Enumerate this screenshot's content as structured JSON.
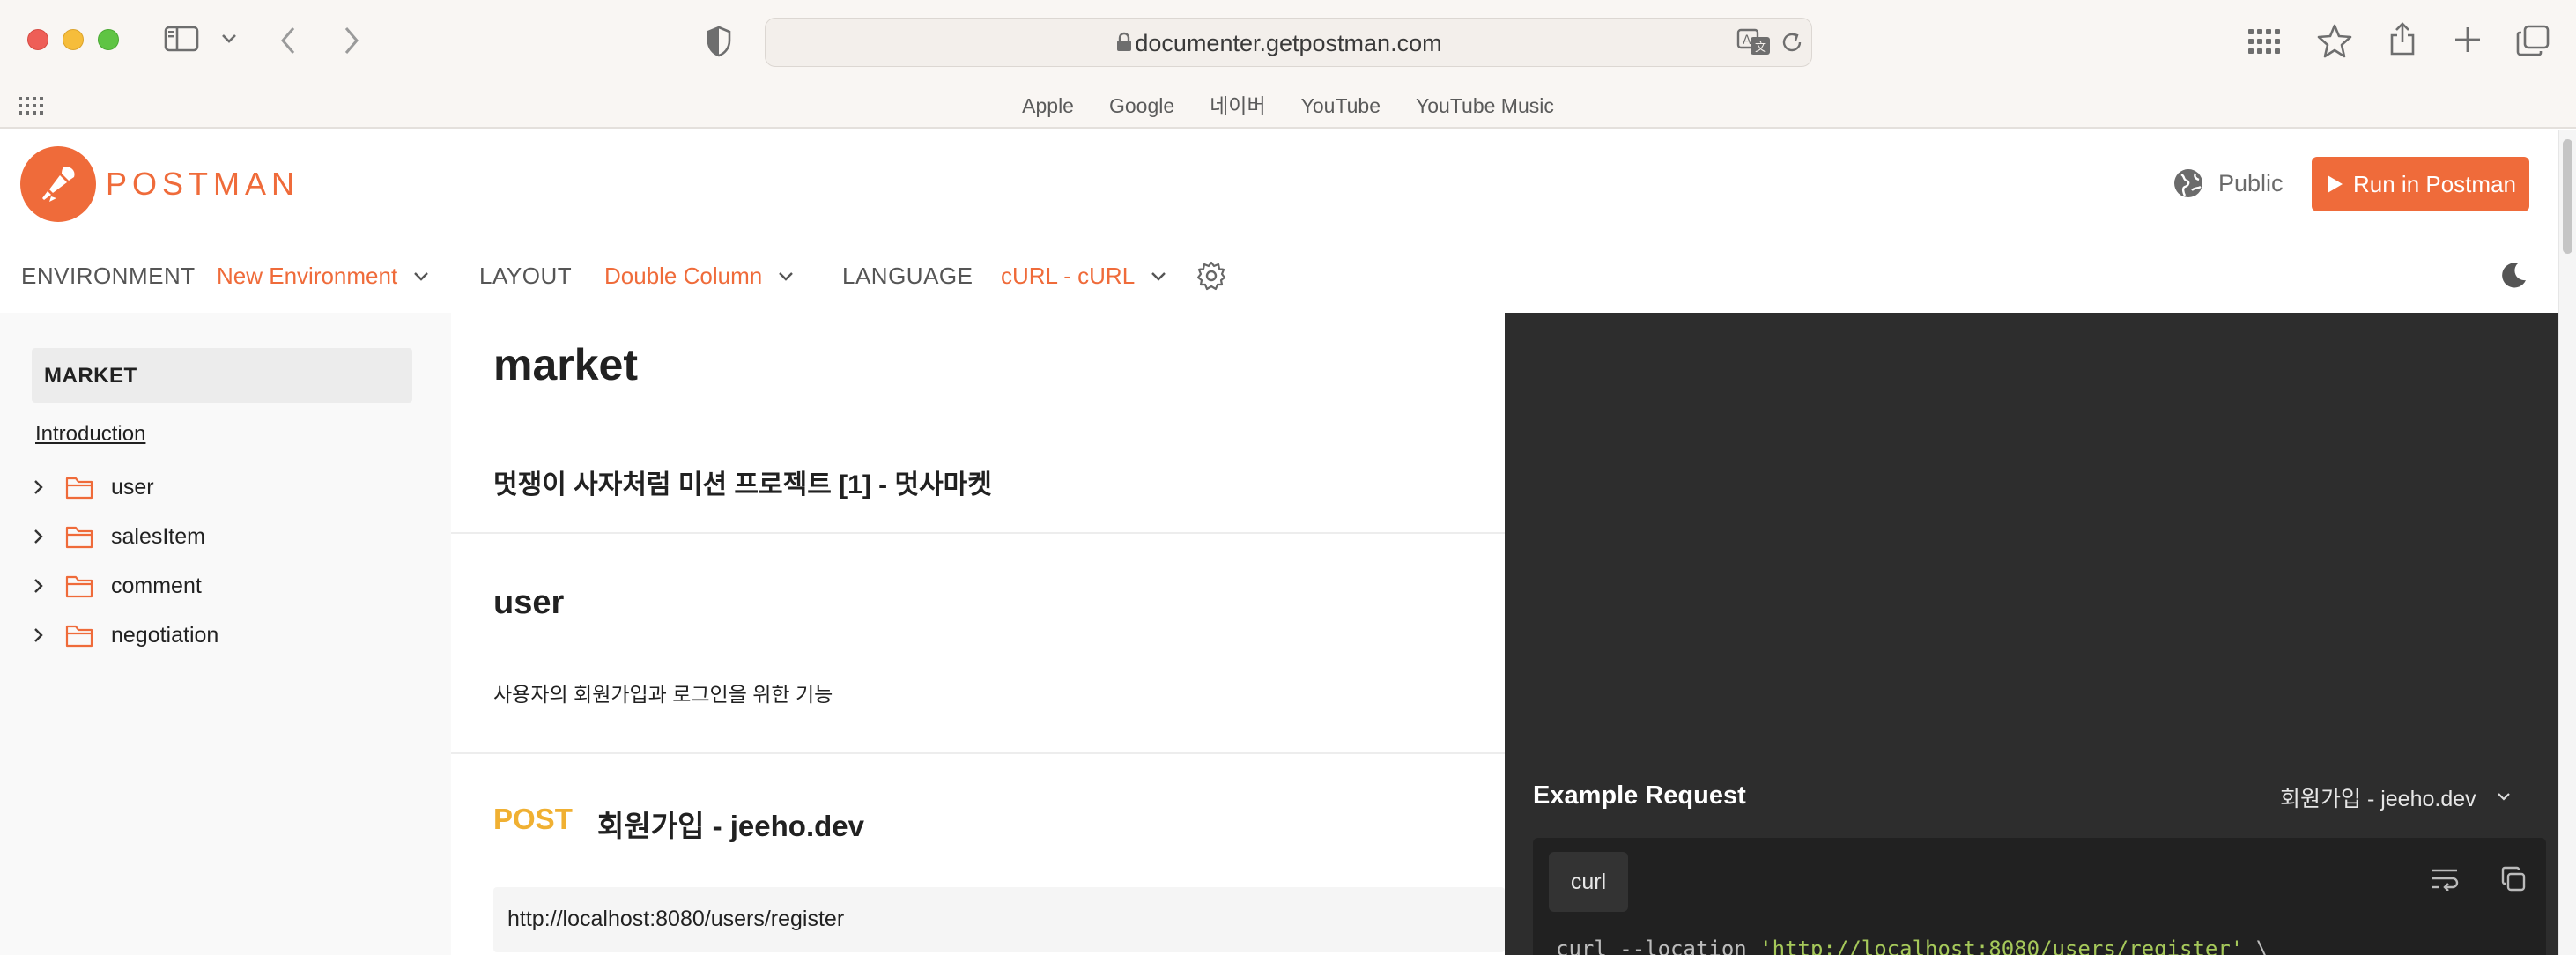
{
  "browser": {
    "url": "documenter.getpostman.com",
    "bookmarks": [
      "Apple",
      "Google",
      "네이버",
      "YouTube",
      "YouTube Music"
    ]
  },
  "header": {
    "logo_text": "POSTMAN",
    "visibility": "Public",
    "run_button": "Run in Postman",
    "brand_color": "#ef6b3a"
  },
  "nav": {
    "environment_label": "ENVIRONMENT",
    "environment_value": "New Environment",
    "layout_label": "LAYOUT",
    "layout_value": "Double Column",
    "language_label": "LANGUAGE",
    "language_value": "cURL - cURL"
  },
  "sidebar": {
    "title": "MARKET",
    "intro": "Introduction",
    "folders": [
      "user",
      "salesItem",
      "comment",
      "negotiation"
    ]
  },
  "main": {
    "title": "market",
    "subtitle": "멋쟁이 사자처럼 미션 프로젝트 [1] - 멋사마켓",
    "section_title": "user",
    "section_desc": "사용자의 회원가입과 로그인을 위한 기능",
    "request": {
      "method": "POST",
      "name": "회원가입 - jeeho.dev",
      "url": "http://localhost:8080/users/register"
    }
  },
  "example": {
    "title": "Example Request",
    "selected": "회원가입 - jeeho.dev",
    "tab": "curl",
    "code_prefix": "curl --location ",
    "code_url": "'http://localhost:8080/users/register'",
    "code_suffix": " \\"
  }
}
